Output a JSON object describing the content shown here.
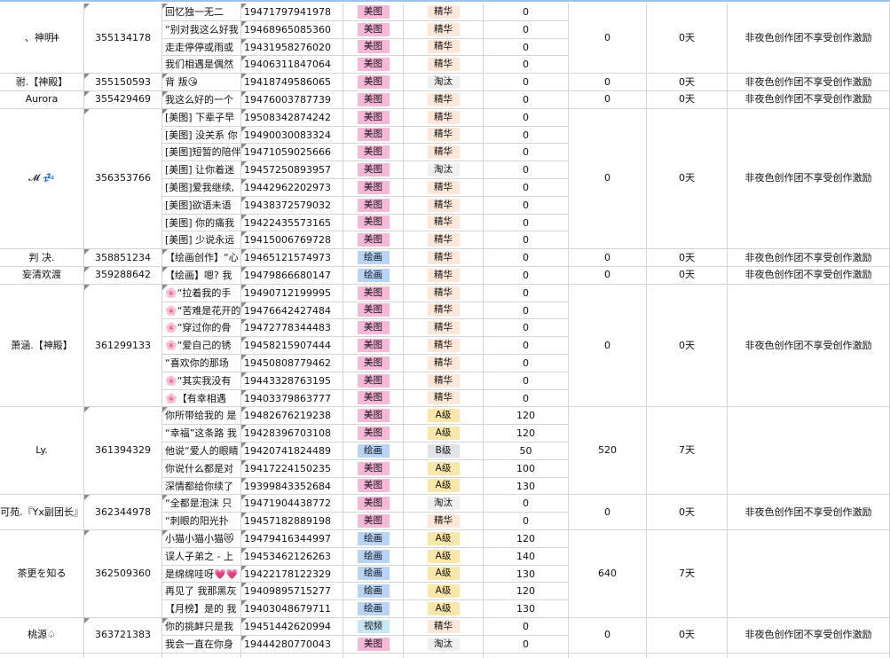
{
  "groups": [
    {
      "name": "、神明†̶̶",
      "id": "355134178",
      "total": "0",
      "days": "0天",
      "note": "非夜色创作团不享受创作激励",
      "rows": [
        {
          "title": "回忆独一无二",
          "code": "19471797941978",
          "type": "美图",
          "grade": "精华",
          "score": "0"
        },
        {
          "title": "“别对我这么好我",
          "code": "19468965085360",
          "type": "美图",
          "grade": "精华",
          "score": "0"
        },
        {
          "title": "走走停停或雨或",
          "code": "19431958276020",
          "type": "美图",
          "grade": "精华",
          "score": "0"
        },
        {
          "title": "我们相遇是偶然",
          "code": "19406311847064",
          "type": "美图",
          "grade": "精华",
          "score": "0"
        }
      ]
    },
    {
      "name": "驸.【神殿】",
      "id": "355150593",
      "total": "0",
      "days": "0天",
      "note": "非夜色创作团不享受创作激励",
      "rows": [
        {
          "title": "背 叛😘",
          "code": "19418749586065",
          "type": "美图",
          "grade": "淘汰",
          "score": "0"
        }
      ]
    },
    {
      "name": "Aurora",
      "id": "355429469",
      "total": "0",
      "days": "0天",
      "note": "非夜色创作团不享受创作激励",
      "rows": [
        {
          "title": "我这么好的一个",
          "code": "19476003787739",
          "type": "美图",
          "grade": "精华",
          "score": "0"
        }
      ]
    },
    {
      "name": "𝓜 💤",
      "id": "356353766",
      "total": "0",
      "days": "0天",
      "note": "非夜色创作团不享受创作激励",
      "rows": [
        {
          "title": "[美图] 下辈子早",
          "code": "19508342874242",
          "type": "美图",
          "grade": "精华",
          "score": "0"
        },
        {
          "title": "[美图] 没关系 你",
          "code": "19490030083324",
          "type": "美图",
          "grade": "精华",
          "score": "0"
        },
        {
          "title": "[美图]短暂的陪伴",
          "code": "19471059025666",
          "type": "美图",
          "grade": "精华",
          "score": "0"
        },
        {
          "title": "[美图] 让你着迷",
          "code": "19457250893957",
          "type": "美图",
          "grade": "淘汰",
          "score": "0"
        },
        {
          "title": "[美图]爱我继续,",
          "code": "19442962202973",
          "type": "美图",
          "grade": "精华",
          "score": "0"
        },
        {
          "title": "[美图]欲语未语",
          "code": "19438372579032",
          "type": "美图",
          "grade": "精华",
          "score": "0"
        },
        {
          "title": "[美图]  你的痛我",
          "code": "19422435573165",
          "type": "美图",
          "grade": "精华",
          "score": "0"
        },
        {
          "title": "[美图]  少说永远",
          "code": "19415006769728",
          "type": "美图",
          "grade": "精华",
          "score": "0"
        }
      ]
    },
    {
      "name": "判  决.",
      "id": "358851234",
      "total": "0",
      "days": "0天",
      "note": "非夜色创作团不享受创作激励",
      "rows": [
        {
          "title": "【绘画创作】“心",
          "code": "19465121574973",
          "type": "绘画",
          "grade": "精华",
          "score": "0"
        }
      ]
    },
    {
      "name": "妄清欢渡",
      "id": "359288642",
      "total": "0",
      "days": "0天",
      "note": "非夜色创作团不享受创作激励",
      "rows": [
        {
          "title": "【绘画】嗯? 我",
          "code": "19479866680147",
          "type": "绘画",
          "grade": "精华",
          "score": "0"
        }
      ]
    },
    {
      "name": "萧涵.【神殿】",
      "id": "361299133",
      "total": "0",
      "days": "0天",
      "note": "非夜色创作团不享受创作激励",
      "rows": [
        {
          "title": "🌸“拉着我的手",
          "code": "19490712199995",
          "type": "美图",
          "grade": "精华",
          "score": "0"
        },
        {
          "title": "🌸“苦难是花开的",
          "code": "19476642427484",
          "type": "美图",
          "grade": "精华",
          "score": "0"
        },
        {
          "title": "🌸“穿过你的骨",
          "code": "19472778344483",
          "type": "美图",
          "grade": "精华",
          "score": "0"
        },
        {
          "title": "🌸“爱自己的锈",
          "code": "19458215907444",
          "type": "美图",
          "grade": "精华",
          "score": "0"
        },
        {
          "title": "“喜欢你的那场",
          "code": "19450808779462",
          "type": "美图",
          "grade": "精华",
          "score": "0"
        },
        {
          "title": "🌸“其实我没有",
          "code": "19443328763195",
          "type": "美图",
          "grade": "精华",
          "score": "0"
        },
        {
          "title": "🌸【有幸相遇",
          "code": "19403379863777",
          "type": "美图",
          "grade": "精华",
          "score": "0"
        }
      ]
    },
    {
      "name": "Ly.",
      "id": "361394329",
      "total": "520",
      "days": "7天",
      "note": "",
      "rows": [
        {
          "title": "你所带给我的 是",
          "code": "19482676219238",
          "type": "美图",
          "grade": "A级",
          "score": "120"
        },
        {
          "title": "“幸福”这条路 我",
          "code": "19428396703108",
          "type": "美图",
          "grade": "A级",
          "score": "120"
        },
        {
          "title": "他说“爱人的眼睛",
          "code": "19420741824489",
          "type": "绘画",
          "grade": "B级",
          "score": "50"
        },
        {
          "title": "你说什么都是对",
          "code": "19417224150235",
          "type": "美图",
          "grade": "A级",
          "score": "100"
        },
        {
          "title": "深情都给你续了",
          "code": "19399843352684",
          "type": "美图",
          "grade": "A级",
          "score": "130"
        }
      ]
    },
    {
      "name": "可苑.『Yx副团长』",
      "id": "362344978",
      "total": "0",
      "days": "0天",
      "note": "非夜色创作团不享受创作激励",
      "rows": [
        {
          "title": "“全都是泡沫 只",
          "code": "19471904438772",
          "type": "美图",
          "grade": "淘汰",
          "score": "0"
        },
        {
          "title": "“刺眼的阳光扑",
          "code": "19457182889198",
          "type": "美图",
          "grade": "精华",
          "score": "0"
        }
      ]
    },
    {
      "name": "茶更を知る",
      "id": "362509360",
      "total": "640",
      "days": "7天",
      "note": "",
      "rows": [
        {
          "title": "小猫小猫小猫😻",
          "code": "19479416344997",
          "type": "绘画",
          "grade": "A级",
          "score": "120"
        },
        {
          "title": "误人子弟之 - 上",
          "code": "19453462126263",
          "type": "绘画",
          "grade": "A级",
          "score": "140"
        },
        {
          "title": "是绵绵哇呀💗💗",
          "code": "19422178122329",
          "type": "绘画",
          "grade": "A级",
          "score": "130"
        },
        {
          "title": "再见了 我那黑灰",
          "code": "19409895715277",
          "type": "绘画",
          "grade": "A级",
          "score": "120"
        },
        {
          "title": "【月榜】是的 我",
          "code": "19403048679711",
          "type": "绘画",
          "grade": "A级",
          "score": "130"
        }
      ]
    },
    {
      "name": "桃源♤",
      "id": "363721383",
      "total": "0",
      "days": "0天",
      "note": "非夜色创作团不享受创作激励",
      "rows": [
        {
          "title": "你的挑衅只是我",
          "code": "19451442620994",
          "type": "视频",
          "grade": "精华",
          "score": "0"
        },
        {
          "title": "我会一直在你身",
          "code": "19444280770043",
          "type": "美图",
          "grade": "淘汰",
          "score": "0"
        }
      ]
    }
  ],
  "colors": {
    "type_meitu": "#f5b8d8",
    "type_huihua": "#b9d3f5",
    "type_shipin": "#c6e8f5",
    "grade_jinghua": "#fde7d8",
    "grade_taotai": "#f0f0f0",
    "grade_a": "#fbe7a9",
    "grade_b": "#dfe3e8",
    "grid": "#d4d4d4"
  }
}
